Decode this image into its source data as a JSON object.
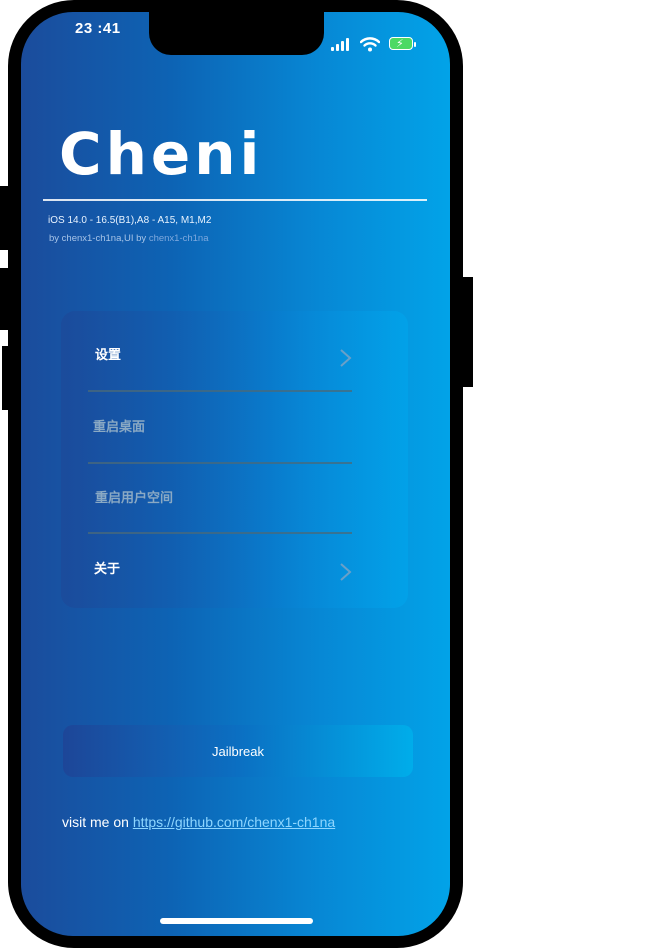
{
  "status_bar": {
    "time": "23 :41",
    "icons": [
      "cellular-signal-icon",
      "wifi-icon",
      "battery-charging-icon"
    ]
  },
  "header": {
    "logo_text": "Cheni",
    "compat_line": "iOS 14.0 - 16.5(B1),A8 - A15, M1,M2",
    "credit_prefix": "by chenx1-ch1na,UI by ",
    "credit_ui_author": "chenx1-ch1na"
  },
  "menu": {
    "items": [
      {
        "label": "设置",
        "color": "#ffffff",
        "has_chevron": true
      },
      {
        "label": "重启桌面",
        "color": "#8aa9c4",
        "has_chevron": false
      },
      {
        "label": "重启用户空间",
        "color": "#8aa9c4",
        "has_chevron": false
      },
      {
        "label": "关于",
        "color": "#ffffff",
        "has_chevron": true
      }
    ]
  },
  "actions": {
    "jailbreak_label": "Jailbreak"
  },
  "footer": {
    "visit_prefix": "visit me on ",
    "link_text": "https://github.com/chenx1-ch1na"
  },
  "colors": {
    "gradient_left": "#1b4c9c",
    "gradient_right": "#02a3e8",
    "link": "#8ed6ff"
  }
}
